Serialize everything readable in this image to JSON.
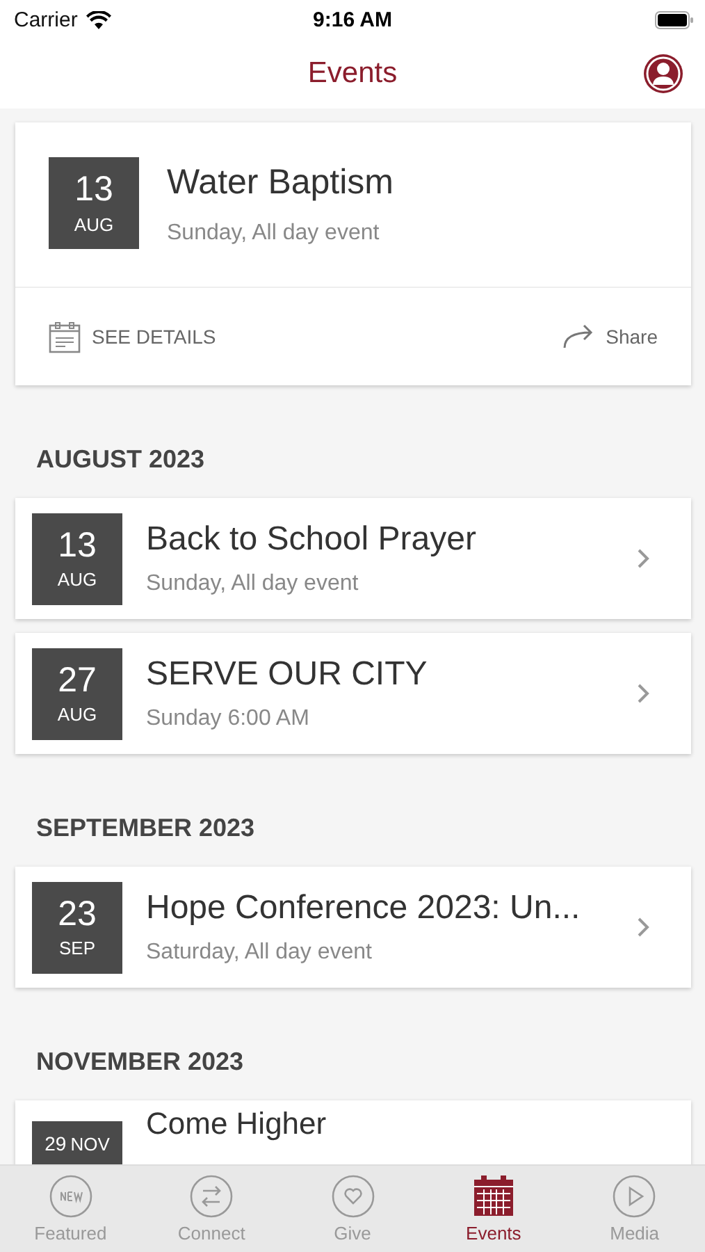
{
  "status_bar": {
    "carrier": "Carrier",
    "time": "9:16 AM"
  },
  "header": {
    "title": "Events"
  },
  "featured": {
    "day": "13",
    "month": "AUG",
    "title": "Water Baptism",
    "subtitle": "Sunday, All day event",
    "details_label": "SEE DETAILS",
    "share_label": "Share"
  },
  "sections": [
    {
      "heading": "AUGUST 2023",
      "events": [
        {
          "day": "13",
          "month": "AUG",
          "title": "Back to School Prayer",
          "subtitle": "Sunday, All day event"
        },
        {
          "day": "27",
          "month": "AUG",
          "title": "SERVE OUR CITY",
          "subtitle": "Sunday 6:00 AM"
        }
      ]
    },
    {
      "heading": "SEPTEMBER 2023",
      "events": [
        {
          "day": "23",
          "month": "SEP",
          "title": "Hope Conference 2023: Un...",
          "subtitle": "Saturday, All day event"
        }
      ]
    },
    {
      "heading": "NOVEMBER 2023",
      "events": [
        {
          "day": "29",
          "month": "NOV",
          "title": "Come Higher",
          "partial": true
        }
      ]
    }
  ],
  "tabs": [
    {
      "label": "Featured",
      "kind": "new",
      "selected": false
    },
    {
      "label": "Connect",
      "kind": "connect",
      "selected": false
    },
    {
      "label": "Give",
      "kind": "give",
      "selected": false
    },
    {
      "label": "Events",
      "kind": "events",
      "selected": true
    },
    {
      "label": "Media",
      "kind": "media",
      "selected": false
    }
  ]
}
